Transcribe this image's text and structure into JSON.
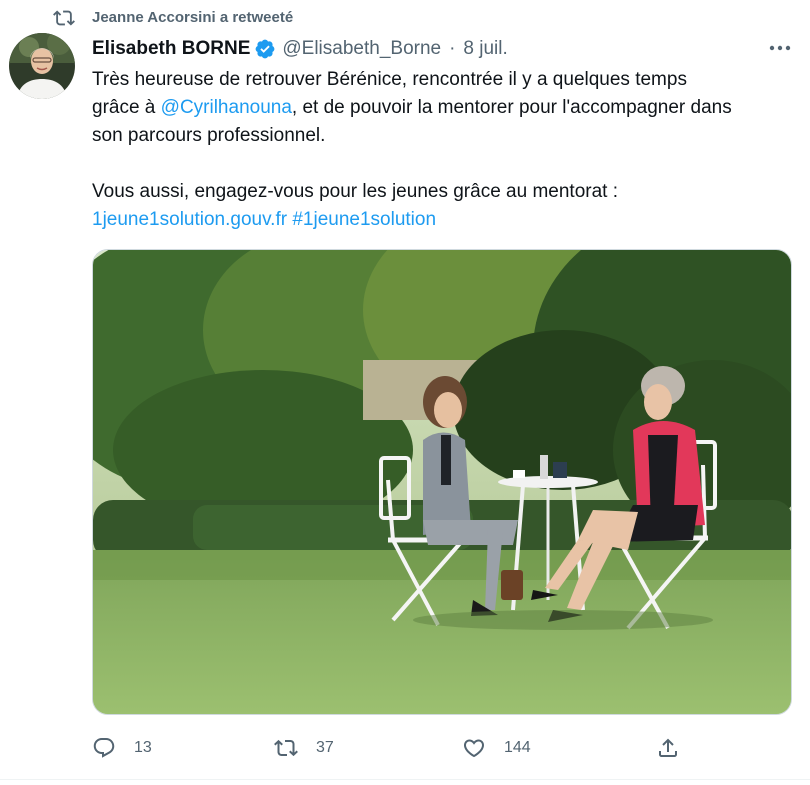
{
  "retweet": {
    "text": "Jeanne Accorsini a retweeté",
    "icon": "retweet-icon"
  },
  "author": {
    "name": "Elisabeth BORNE",
    "handle": "@Elisabeth_Borne",
    "separator": "·",
    "date": "8 juil.",
    "verified_color": "#1d9bf0"
  },
  "tweet": {
    "line1_a": "Très heureuse de retrouver Bérénice, rencontrée il y a quelques temps",
    "line2_a": "grâce à ",
    "mention": "@Cyrilhanouna",
    "line2_b": ", et de pouvoir la mentorer pour l'accompagner dans",
    "line3": "son parcours professionnel.",
    "line4": "Vous aussi, engagez-vous pour les jeunes grâce au mentorat :",
    "link": "1jeune1solution.gouv.fr",
    "hashtag": "#1jeune1solution"
  },
  "actions": {
    "replies": "13",
    "retweets": "37",
    "likes": "144"
  },
  "colors": {
    "link": "#1d9bf0",
    "secondary": "#536471",
    "text": "#0f1419"
  }
}
